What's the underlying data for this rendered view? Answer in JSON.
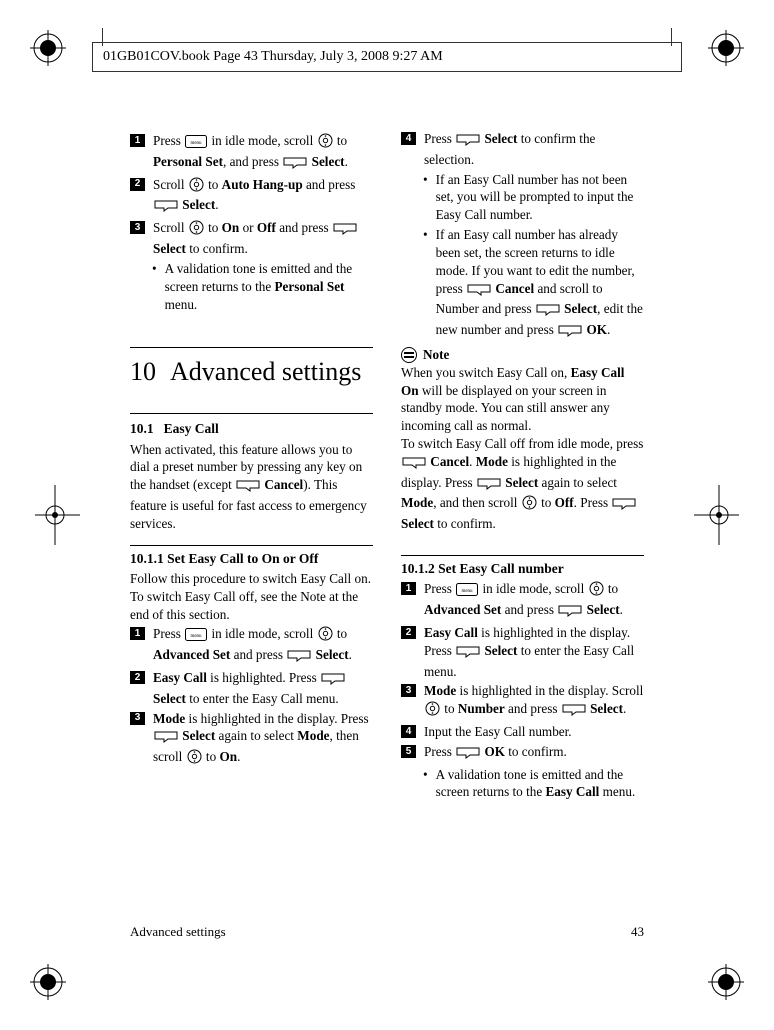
{
  "crop_header": "01GB01COV.book  Page 43  Thursday, July 3, 2008  9:27 AM",
  "top_steps": [
    {
      "n": "1",
      "pre": "Press ",
      "icon": "menu",
      "mid1": " in idle mode, scroll ",
      "icon2": "nav",
      "mid2": " to ",
      "b1": "Personal Set",
      "mid3": ", and press ",
      "icon3": "softkey-left",
      "b2": " Select",
      "tail": "."
    },
    {
      "n": "2",
      "pre": "Scroll ",
      "icon": "nav",
      "mid1": " to ",
      "b1": "Auto Hang-up",
      "mid2": " and press ",
      "icon2": "softkey-left",
      "b2": " Select",
      "tail": "."
    },
    {
      "n": "3",
      "pre": "Scroll ",
      "icon": "nav",
      "mid1": " to ",
      "b1": "On",
      "mid2": " or ",
      "b2": "Off",
      "mid3": " and press ",
      "icon2": "softkey-left",
      "b3": " Select",
      "tail": " to confirm."
    }
  ],
  "top_bullet": "A validation tone is emitted and the screen returns to the",
  "top_bullet_b": "Personal Set",
  "top_bullet_tail": " menu.",
  "h1_num": "10",
  "h1_title": "Advanced settings",
  "h2_num": "10.1",
  "h2_title": "Easy Call",
  "h2_body_pre": "When activated, this feature allows you to dial a preset number by pressing any key on the handset (except ",
  "h2_body_b": "Cancel",
  "h2_body_tail": "). This feature is useful for fast access to emergency services.",
  "h3a_title": "10.1.1 Set Easy Call to On or Off",
  "h3a_body": "Follow this procedure to switch Easy Call on. To switch Easy Call off, see the Note at the end of this section.",
  "h3a_steps": {
    "s1": {
      "n": "1",
      "t1": "Press ",
      "t2": " in idle mode, scroll ",
      "t3": " to ",
      "b1": "Advanced Set",
      "t4": " and press ",
      "b2": " Select",
      "t5": "."
    },
    "s2": {
      "n": "2",
      "b1": "Easy Call",
      "t1": " is highlighted. Press ",
      "b2": " Select",
      "t2": " to enter the Easy Call menu."
    },
    "s3": {
      "n": "3",
      "b1": "Mode",
      "t1": " is highlighted in the display. Press ",
      "b2": " Select",
      "t2": " again to select ",
      "b3": "Mode",
      "t3": ", then scroll ",
      "t4": " to ",
      "b4": "On",
      "t5": "."
    },
    "s4": {
      "n": "4",
      "t1": "Press ",
      "b1": " Select",
      "t2": " to confirm the selection."
    }
  },
  "col2_bullets": [
    "If an Easy Call number has not been set, you will be prompted to input the Easy Call number.",
    "If an Easy call number has already been set, the screen returns to idle mode. If you want to edit the number, press |softkey-right| |b|Cancel|/b| and scroll to Number and press |softkey-left| |b|Select|/b|, edit the new number and press |softkey-left| |b|OK|/b|."
  ],
  "note_label": "Note",
  "note_body": "When you switch Easy Call on, |b|Easy Call On|/b| will be displayed on your screen in standby mode. You can still answer any incoming call as normal.",
  "note_body2": "To switch Easy Call off from idle mode, press |softkey-right| |b|Cancel|/b|. |b|Mode|/b| is highlighted in the display. Press |softkey-left| |b|Select|/b| again to select |b|Mode|/b|, and then scroll |nav| to |b|Off|/b|. Press |softkey-left| |b|Select|/b| to confirm.",
  "h3b_title": "10.1.2 Set Easy Call number",
  "h3b_steps": {
    "s1": {
      "n": "1",
      "txt": "Press |menu| in idle mode, scroll |nav| to |b|Advanced Set|/b| and press |softkey-left| |b|Select|/b|."
    },
    "s2": {
      "n": "2",
      "txt": "|b|Easy Call|/b| is highlighted in the display. Press |softkey-left| |b|Select|/b| to enter the Easy Call menu."
    },
    "s3": {
      "n": "3",
      "txt": "|b|Mode|/b| is highlighted in the display. Scroll |nav| to |b|Number|/b| and press |softkey-left| |b|Select|/b|."
    },
    "s4": {
      "n": "4",
      "txt": "Input the Easy Call number."
    },
    "s5": {
      "n": "5",
      "txt": "Press |softkey-left| |b|OK|/b| to confirm."
    }
  },
  "h3b_bullet": "A validation tone is emitted and the screen returns to the |b|Easy Call|/b| menu.",
  "footer_section": "Advanced settings",
  "footer_page": "43"
}
